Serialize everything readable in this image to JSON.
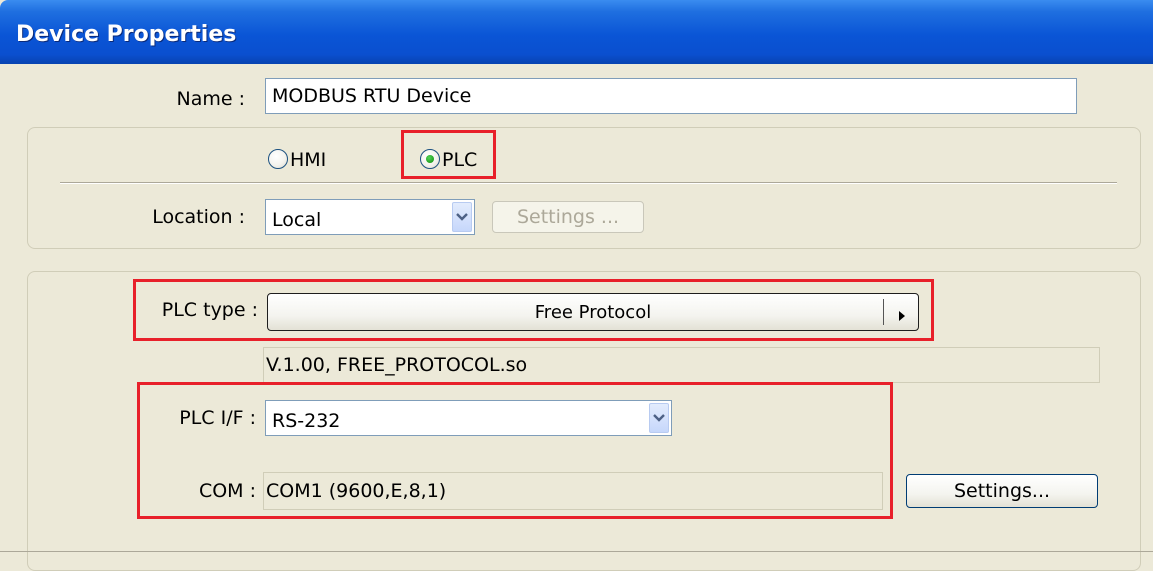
{
  "window": {
    "title": "Device Properties"
  },
  "name": {
    "label": "Name :",
    "value": "MODBUS RTU Device"
  },
  "device_kind": {
    "hmi_label": "HMI",
    "plc_label": "PLC",
    "selected": "PLC"
  },
  "location": {
    "label": "Location :",
    "value": "Local",
    "settings_label": "Settings ..."
  },
  "plc": {
    "type_label": "PLC type :",
    "type_value": "Free Protocol",
    "driver_info": "V.1.00, FREE_PROTOCOL.so",
    "if_label": "PLC I/F :",
    "if_value": "RS-232",
    "com_label": "COM :",
    "com_value": "COM1 (9600,E,8,1)",
    "com_settings_label": "Settings..."
  },
  "colors": {
    "titlebar": "#0a55d6",
    "dialog_bg": "#ece9d8",
    "highlight": "#e8202a",
    "radio_selected": "#21a121"
  },
  "icons": {
    "dropdown": "chevron-down-icon",
    "submenu": "triangle-right-icon"
  }
}
